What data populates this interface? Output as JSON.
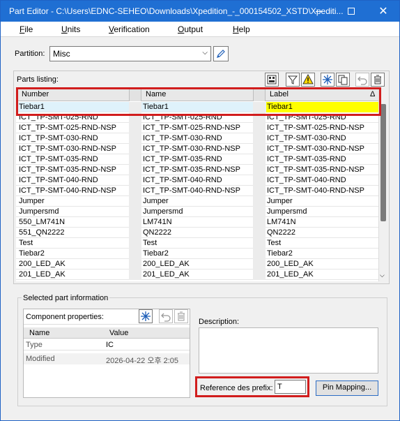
{
  "window": {
    "title": "Part Editor - C:\\Users\\EDNC-SEHEO\\Downloads\\Xpedition_-_000154502_XSTD\\Xpediti..."
  },
  "menu": [
    "File",
    "Units",
    "Verification",
    "Output",
    "Help"
  ],
  "partition": {
    "label": "Partition:",
    "value": "Misc"
  },
  "parts_listing": {
    "label": "Parts listing:",
    "columns": [
      "Number",
      "Name",
      "Label"
    ],
    "sort_indicator": "Δ",
    "rows": [
      {
        "number": "Tiebar1",
        "name": "Tiebar1",
        "label": "Tiebar1"
      },
      {
        "number": "ICT_TP-SMT-025-RND",
        "name": "ICT_TP-SMT-025-RND",
        "label": "ICT_TP-SMT-025-RND"
      },
      {
        "number": "ICT_TP-SMT-025-RND-NSP",
        "name": "ICT_TP-SMT-025-RND-NSP",
        "label": "ICT_TP-SMT-025-RND-NSP"
      },
      {
        "number": "ICT_TP-SMT-030-RND",
        "name": "ICT_TP-SMT-030-RND",
        "label": "ICT_TP-SMT-030-RND"
      },
      {
        "number": "ICT_TP-SMT-030-RND-NSP",
        "name": "ICT_TP-SMT-030-RND-NSP",
        "label": "ICT_TP-SMT-030-RND-NSP"
      },
      {
        "number": "ICT_TP-SMT-035-RND",
        "name": "ICT_TP-SMT-035-RND",
        "label": "ICT_TP-SMT-035-RND"
      },
      {
        "number": "ICT_TP-SMT-035-RND-NSP",
        "name": "ICT_TP-SMT-035-RND-NSP",
        "label": "ICT_TP-SMT-035-RND-NSP"
      },
      {
        "number": "ICT_TP-SMT-040-RND",
        "name": "ICT_TP-SMT-040-RND",
        "label": "ICT_TP-SMT-040-RND"
      },
      {
        "number": "ICT_TP-SMT-040-RND-NSP",
        "name": "ICT_TP-SMT-040-RND-NSP",
        "label": "ICT_TP-SMT-040-RND-NSP"
      },
      {
        "number": "Jumper",
        "name": "Jumper",
        "label": "Jumper"
      },
      {
        "number": "Jumpersmd",
        "name": "Jumpersmd",
        "label": "Jumpersmd"
      },
      {
        "number": "550_LM741N",
        "name": "LM741N",
        "label": "LM741N"
      },
      {
        "number": "551_QN2222",
        "name": "QN2222",
        "label": "QN2222"
      },
      {
        "number": "Test",
        "name": "Test",
        "label": "Test"
      },
      {
        "number": "Tiebar2",
        "name": "Tiebar2",
        "label": "Tiebar2"
      },
      {
        "number": "200_LED_AK",
        "name": "200_LED_AK",
        "label": "200_LED_AK"
      },
      {
        "number": "201_LED_AK",
        "name": "201_LED_AK",
        "label": "201_LED_AK"
      }
    ]
  },
  "selected_part": {
    "group_label": "Selected part information",
    "component_properties_label": "Component properties:",
    "prop_headers": [
      "Name",
      "Value"
    ],
    "props": [
      {
        "name": "Type",
        "value": "IC"
      }
    ],
    "modified_label": "Modified",
    "modified_value": "2026-04-22 오후 2:05",
    "description_label": "Description:",
    "refdes_label": "Reference des prefix:",
    "refdes_value": "T",
    "pin_mapping_label": "Pin Mapping..."
  },
  "colors": {
    "titlebar": "#1f6fd3",
    "highlight": "#ffff00",
    "annotation": "#d11d1d"
  }
}
